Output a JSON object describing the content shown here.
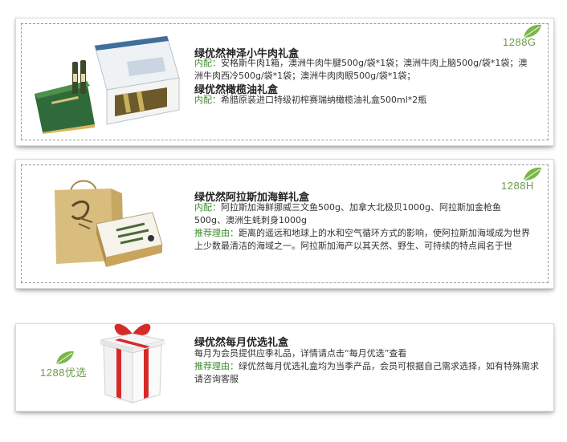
{
  "products": [
    {
      "code": "1288G",
      "title_1": "绿优然神泽小牛肉礼盒",
      "label_1": "内配：",
      "content_1": "安格斯牛肉1箱，澳洲牛肉牛腱500g/袋*1袋；澳洲牛肉上脑500g/袋*1袋；澳洲牛肉西冷500g/袋*1袋；澳洲牛肉肉眼500g/袋*1袋；",
      "title_2": "绿优然橄榄油礼盒",
      "label_2": "内配：",
      "content_2": "希腊原装进口特级初榨赛瑞纳橄榄油礼盒500ml*2瓶"
    },
    {
      "code": "1288H",
      "title": "绿优然阿拉斯加海鲜礼盒",
      "label_1": "内配：",
      "content_1": "阿拉斯加海鲜挪威三文鱼500g、加拿大北极贝1000g、阿拉斯加金枪鱼500g、澳洲生蚝刺身1000g",
      "label_2": "推荐理由：",
      "content_2": "距离的遥远和地球上的水和空气循环方式的影响，使阿拉斯加海域成为世界上少数最清洁的海域之一。阿拉斯加海产以其天然、野生、可持续的特点闻名于世"
    },
    {
      "code": "1288优选",
      "title": "绿优然每月优选礼盒",
      "content_1": "每月为会员提供应季礼品，详情请点击“每月优选”查看",
      "label_2": "推荐理由：",
      "content_2": "绿优然每月优选礼盒均为当季产品，会员可根据自己需求选择，如有特殊需求请咨询客服"
    }
  ],
  "colors": {
    "accent_green": "#3d8b2f",
    "code_green": "#6a9a4a",
    "leaf_green": "#7ab648"
  },
  "icons": [
    "leaf-icon"
  ]
}
